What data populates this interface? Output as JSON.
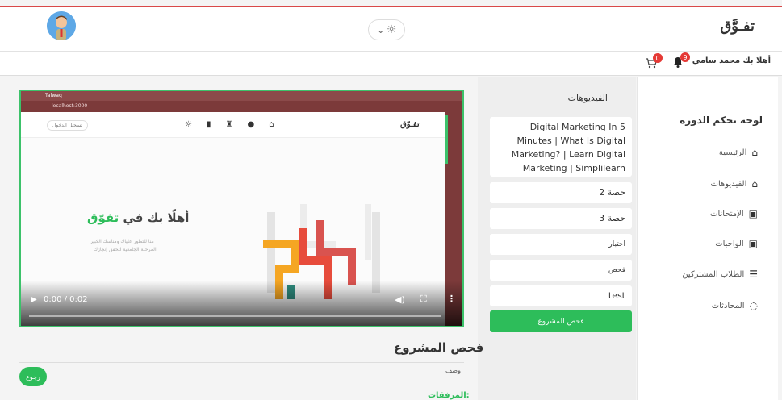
{
  "header": {
    "logo": "تفـوَّق",
    "theme_toggle_icon": "sun-icon",
    "theme_toggle_caret": "⌄"
  },
  "userbar": {
    "greeting": "أهلا بك محمد سامي",
    "notifications_count": "9",
    "cart_count": "0"
  },
  "sidebar": {
    "title": "لوحة تحكم الدورة",
    "items": [
      {
        "label": "الرئيسية",
        "icon": "home-icon"
      },
      {
        "label": "الفيديوهات",
        "icon": "home-icon"
      },
      {
        "label": "الإمتحانات",
        "icon": "user-box-icon"
      },
      {
        "label": "الواجبات",
        "icon": "user-box-icon"
      },
      {
        "label": "الطلاب المشتركين",
        "icon": "list-icon"
      },
      {
        "label": "المحادثات",
        "icon": "chat-icon"
      }
    ]
  },
  "videos": {
    "heading": "الفيديوهات",
    "items": [
      "Digital Marketing In 5 Minutes | What Is Digital Marketing? | Learn Digital Marketing | Simplilearn",
      "حصة 2",
      "حصة 3",
      "اختبار",
      "فحص",
      "test"
    ],
    "active_button": "فحص المشروع"
  },
  "player": {
    "browser_tab": "Tafwaq",
    "browser_url": "localhost:3000",
    "inner_logo": "تفـوّق",
    "inner_login": "تسجيل الدخول",
    "welcome_prefix": "أهلًا بك في ",
    "welcome_brand": "تفوّق",
    "subtext_line1": "منا للتطور علياك ومناسك الكبير",
    "subtext_line2": "المرحلة الجامعية لتحقق إنجازك",
    "time": "0:00 / 0:02"
  },
  "project": {
    "title": "فحص المشروع",
    "description_label": "وصف",
    "back_button": "رجوع",
    "attachments_label": "المرفقات:"
  },
  "colors": {
    "accent": "#2dbd5a",
    "badge": "#e53935"
  }
}
